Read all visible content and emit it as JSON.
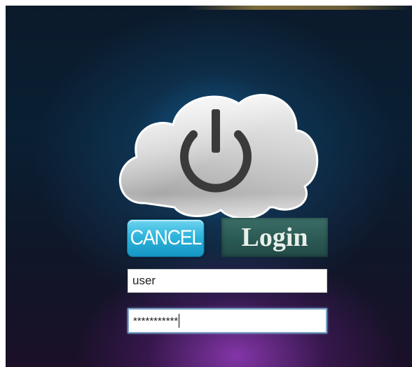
{
  "buttons": {
    "cancel_label": "CANCEL",
    "login_label": "Login"
  },
  "form": {
    "username_value": "user",
    "password_value": "***********"
  },
  "icons": {
    "center": "power-icon"
  },
  "colors": {
    "cancel_button": "#2fb5dd",
    "login_button": "#2c5b55",
    "glow_top": "#28beff",
    "glow_bottom": "#963cbe"
  }
}
